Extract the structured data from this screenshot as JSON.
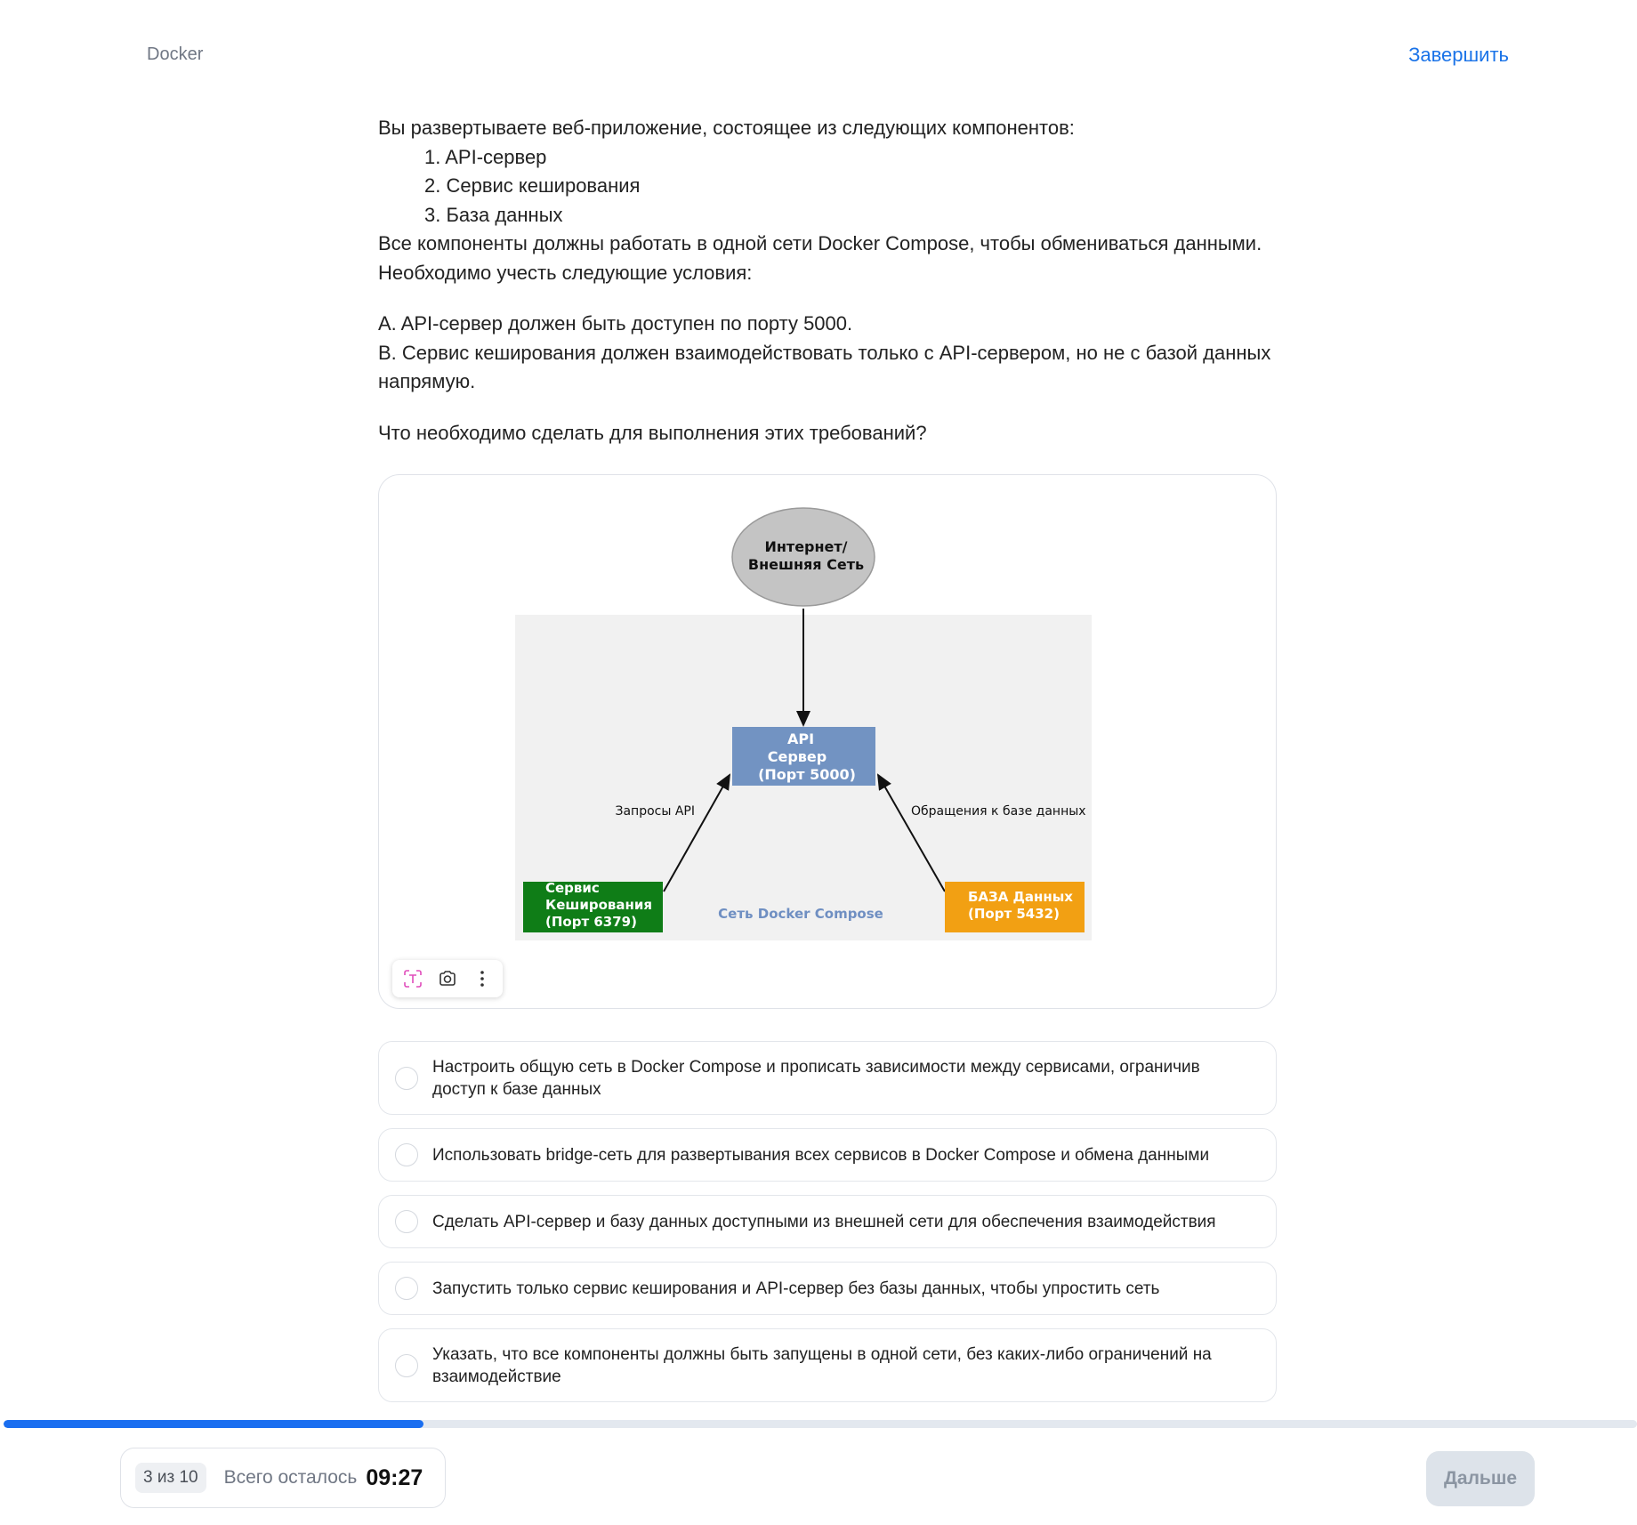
{
  "header": {
    "course_title": "Docker",
    "finish_label": "Завершить"
  },
  "question": {
    "intro": "Вы развертываете веб-приложение, состоящее из следующих компонентов:",
    "components": [
      "1. API-сервер",
      "2. Сервис кеширования",
      "3. База данных"
    ],
    "network_note": "Все компоненты должны работать в одной сети Docker Compose, чтобы обмениваться данными.",
    "conditions_intro": "Необходимо учесть следующие условия:",
    "condition_a": "A. API-сервер должен быть доступен по порту 5000.",
    "condition_b": "B. Сервис кеширования должен взаимодействовать только с API-сервером, но не с базой данных напрямую.",
    "prompt": "Что необходимо сделать для выполнения этих требований?"
  },
  "diagram": {
    "internet_line1": "Интернет/",
    "internet_line2": "Внешняя Сеть",
    "api_line1": "API",
    "api_line2": "Сервер",
    "api_line3": "(Порт 5000)",
    "api_requests_label": "Запросы API",
    "db_calls_label": "Обращения к базе данных",
    "cache_line1": "Сервис",
    "cache_line2": "Кеширования",
    "cache_line3": "(Порт 6379)",
    "db_line1": "БАЗА Данных",
    "db_line2": "(Порт 5432)",
    "network_label": "Сеть Docker Compose",
    "colors": {
      "internet": "#c4c4c4",
      "api": "#7293c2",
      "cache": "#0f7d17",
      "db": "#f2a013",
      "network_bg": "#f1f1f1",
      "network_label": "#6f8fc2"
    }
  },
  "image_toolbar": {
    "icons": [
      "text-recognition-icon",
      "camera-icon",
      "more-vertical-icon"
    ]
  },
  "answers": [
    "Настроить общую сеть в Docker Compose и прописать зависимости между сервисами, ограничив доступ к базе данных",
    "Использовать bridge-сеть для развертывания всех сервисов в Docker Compose и обмена данными",
    "Сделать API-сервер и базу данных доступными из внешней сети для обеспечения взаимодействия",
    "Запустить только сервис кеширования и API-сервер без базы данных, чтобы упростить сеть",
    "Указать, что все компоненты должны быть запущены в одной сети, без каких-либо ограничений на взаимодействие"
  ],
  "footer": {
    "counter": "3 из 10",
    "remaining_label": "Всего осталось",
    "timer": "09:27",
    "next_label": "Дальше",
    "progress_fraction": 0.257,
    "accent_color": "#1a6ef0"
  }
}
